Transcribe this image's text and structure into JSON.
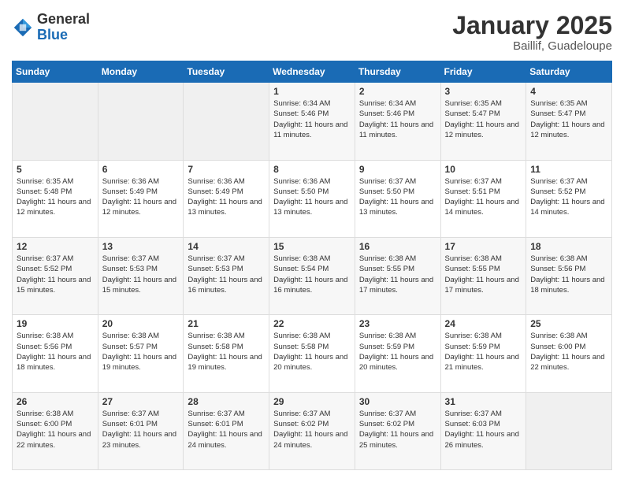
{
  "logo": {
    "general": "General",
    "blue": "Blue"
  },
  "header": {
    "month_year": "January 2025",
    "location": "Baillif, Guadeloupe"
  },
  "weekdays": [
    "Sunday",
    "Monday",
    "Tuesday",
    "Wednesday",
    "Thursday",
    "Friday",
    "Saturday"
  ],
  "weeks": [
    [
      {
        "day": "",
        "info": ""
      },
      {
        "day": "",
        "info": ""
      },
      {
        "day": "",
        "info": ""
      },
      {
        "day": "1",
        "info": "Sunrise: 6:34 AM\nSunset: 5:46 PM\nDaylight: 11 hours and 11 minutes."
      },
      {
        "day": "2",
        "info": "Sunrise: 6:34 AM\nSunset: 5:46 PM\nDaylight: 11 hours and 11 minutes."
      },
      {
        "day": "3",
        "info": "Sunrise: 6:35 AM\nSunset: 5:47 PM\nDaylight: 11 hours and 12 minutes."
      },
      {
        "day": "4",
        "info": "Sunrise: 6:35 AM\nSunset: 5:47 PM\nDaylight: 11 hours and 12 minutes."
      }
    ],
    [
      {
        "day": "5",
        "info": "Sunrise: 6:35 AM\nSunset: 5:48 PM\nDaylight: 11 hours and 12 minutes."
      },
      {
        "day": "6",
        "info": "Sunrise: 6:36 AM\nSunset: 5:49 PM\nDaylight: 11 hours and 12 minutes."
      },
      {
        "day": "7",
        "info": "Sunrise: 6:36 AM\nSunset: 5:49 PM\nDaylight: 11 hours and 13 minutes."
      },
      {
        "day": "8",
        "info": "Sunrise: 6:36 AM\nSunset: 5:50 PM\nDaylight: 11 hours and 13 minutes."
      },
      {
        "day": "9",
        "info": "Sunrise: 6:37 AM\nSunset: 5:50 PM\nDaylight: 11 hours and 13 minutes."
      },
      {
        "day": "10",
        "info": "Sunrise: 6:37 AM\nSunset: 5:51 PM\nDaylight: 11 hours and 14 minutes."
      },
      {
        "day": "11",
        "info": "Sunrise: 6:37 AM\nSunset: 5:52 PM\nDaylight: 11 hours and 14 minutes."
      }
    ],
    [
      {
        "day": "12",
        "info": "Sunrise: 6:37 AM\nSunset: 5:52 PM\nDaylight: 11 hours and 15 minutes."
      },
      {
        "day": "13",
        "info": "Sunrise: 6:37 AM\nSunset: 5:53 PM\nDaylight: 11 hours and 15 minutes."
      },
      {
        "day": "14",
        "info": "Sunrise: 6:37 AM\nSunset: 5:53 PM\nDaylight: 11 hours and 16 minutes."
      },
      {
        "day": "15",
        "info": "Sunrise: 6:38 AM\nSunset: 5:54 PM\nDaylight: 11 hours and 16 minutes."
      },
      {
        "day": "16",
        "info": "Sunrise: 6:38 AM\nSunset: 5:55 PM\nDaylight: 11 hours and 17 minutes."
      },
      {
        "day": "17",
        "info": "Sunrise: 6:38 AM\nSunset: 5:55 PM\nDaylight: 11 hours and 17 minutes."
      },
      {
        "day": "18",
        "info": "Sunrise: 6:38 AM\nSunset: 5:56 PM\nDaylight: 11 hours and 18 minutes."
      }
    ],
    [
      {
        "day": "19",
        "info": "Sunrise: 6:38 AM\nSunset: 5:56 PM\nDaylight: 11 hours and 18 minutes."
      },
      {
        "day": "20",
        "info": "Sunrise: 6:38 AM\nSunset: 5:57 PM\nDaylight: 11 hours and 19 minutes."
      },
      {
        "day": "21",
        "info": "Sunrise: 6:38 AM\nSunset: 5:58 PM\nDaylight: 11 hours and 19 minutes."
      },
      {
        "day": "22",
        "info": "Sunrise: 6:38 AM\nSunset: 5:58 PM\nDaylight: 11 hours and 20 minutes."
      },
      {
        "day": "23",
        "info": "Sunrise: 6:38 AM\nSunset: 5:59 PM\nDaylight: 11 hours and 20 minutes."
      },
      {
        "day": "24",
        "info": "Sunrise: 6:38 AM\nSunset: 5:59 PM\nDaylight: 11 hours and 21 minutes."
      },
      {
        "day": "25",
        "info": "Sunrise: 6:38 AM\nSunset: 6:00 PM\nDaylight: 11 hours and 22 minutes."
      }
    ],
    [
      {
        "day": "26",
        "info": "Sunrise: 6:38 AM\nSunset: 6:00 PM\nDaylight: 11 hours and 22 minutes."
      },
      {
        "day": "27",
        "info": "Sunrise: 6:37 AM\nSunset: 6:01 PM\nDaylight: 11 hours and 23 minutes."
      },
      {
        "day": "28",
        "info": "Sunrise: 6:37 AM\nSunset: 6:01 PM\nDaylight: 11 hours and 24 minutes."
      },
      {
        "day": "29",
        "info": "Sunrise: 6:37 AM\nSunset: 6:02 PM\nDaylight: 11 hours and 24 minutes."
      },
      {
        "day": "30",
        "info": "Sunrise: 6:37 AM\nSunset: 6:02 PM\nDaylight: 11 hours and 25 minutes."
      },
      {
        "day": "31",
        "info": "Sunrise: 6:37 AM\nSunset: 6:03 PM\nDaylight: 11 hours and 26 minutes."
      },
      {
        "day": "",
        "info": ""
      }
    ]
  ]
}
